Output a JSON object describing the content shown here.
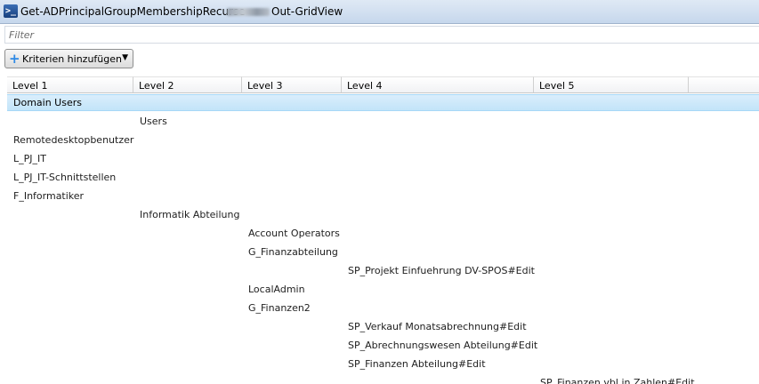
{
  "window": {
    "title": "Get-ADPrincipalGroupMembershipRecurse",
    "subtitle": "Out-GridView"
  },
  "filter": {
    "placeholder": "Filter"
  },
  "toolbar": {
    "add_criteria_label": "Kriterien hinzufügen"
  },
  "columns": [
    "Level 1",
    "Level 2",
    "Level 3",
    "Level 4",
    "Level 5"
  ],
  "rows": [
    {
      "level": 1,
      "text": "Domain Users",
      "selected": true
    },
    {
      "level": 2,
      "text": "Users"
    },
    {
      "level": 1,
      "text": "Remotedesktopbenutzer"
    },
    {
      "level": 1,
      "text": "L_PJ_IT"
    },
    {
      "level": 1,
      "text": "L_PJ_IT-Schnittstellen"
    },
    {
      "level": 1,
      "text": "F_Informatiker"
    },
    {
      "level": 2,
      "text": "Informatik Abteilung"
    },
    {
      "level": 3,
      "text": "Account Operators"
    },
    {
      "level": 3,
      "text": "G_Finanzabteilung"
    },
    {
      "level": 4,
      "text": "SP_Projekt Einfuehrung DV-SPOS#Edit"
    },
    {
      "level": 3,
      "text": "LocalAdmin"
    },
    {
      "level": 3,
      "text": "G_Finanzen2"
    },
    {
      "level": 4,
      "text": "SP_Verkauf Monatsabrechnung#Edit"
    },
    {
      "level": 4,
      "text": "SP_Abrechnungswesen Abteilung#Edit"
    },
    {
      "level": 4,
      "text": "SP_Finanzen Abteilung#Edit"
    },
    {
      "level": 5,
      "text": "SP_Finanzen vbl in Zahlen#Edit"
    }
  ]
}
